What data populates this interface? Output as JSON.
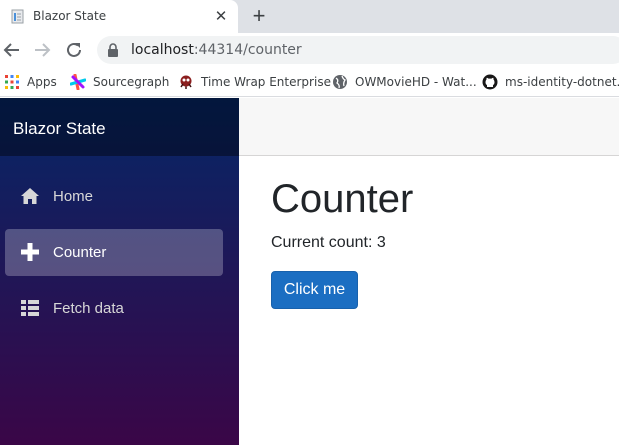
{
  "browser": {
    "tab_title": "Blazor State",
    "close_tab_glyph": "✕",
    "new_tab_glyph": "+",
    "url_host": "localhost",
    "url_path": ":44314/counter",
    "bookmarks": [
      {
        "label": "Apps",
        "icon": "apps-grid-icon"
      },
      {
        "label": "Sourcegraph",
        "icon": "sourcegraph-icon"
      },
      {
        "label": "Time Wrap Enterprise",
        "icon": "time-wrap-icon"
      },
      {
        "label": "OWMovieHD - Wat...",
        "icon": "globe-icon"
      },
      {
        "label": "ms-identity-dotnet...",
        "icon": "github-icon"
      }
    ]
  },
  "app": {
    "brand": "Blazor State",
    "nav": [
      {
        "label": "Home",
        "icon": "home-icon",
        "active": false
      },
      {
        "label": "Counter",
        "icon": "plus-icon",
        "active": true
      },
      {
        "label": "Fetch data",
        "icon": "list-icon",
        "active": false
      }
    ],
    "page_title": "Counter",
    "count_label": "Current count: 3",
    "button_label": "Click me"
  },
  "colors": {
    "sidebar_top": "#052767",
    "sidebar_bottom": "#3a0647",
    "button": "#1b6ec2",
    "text": "#212529"
  }
}
